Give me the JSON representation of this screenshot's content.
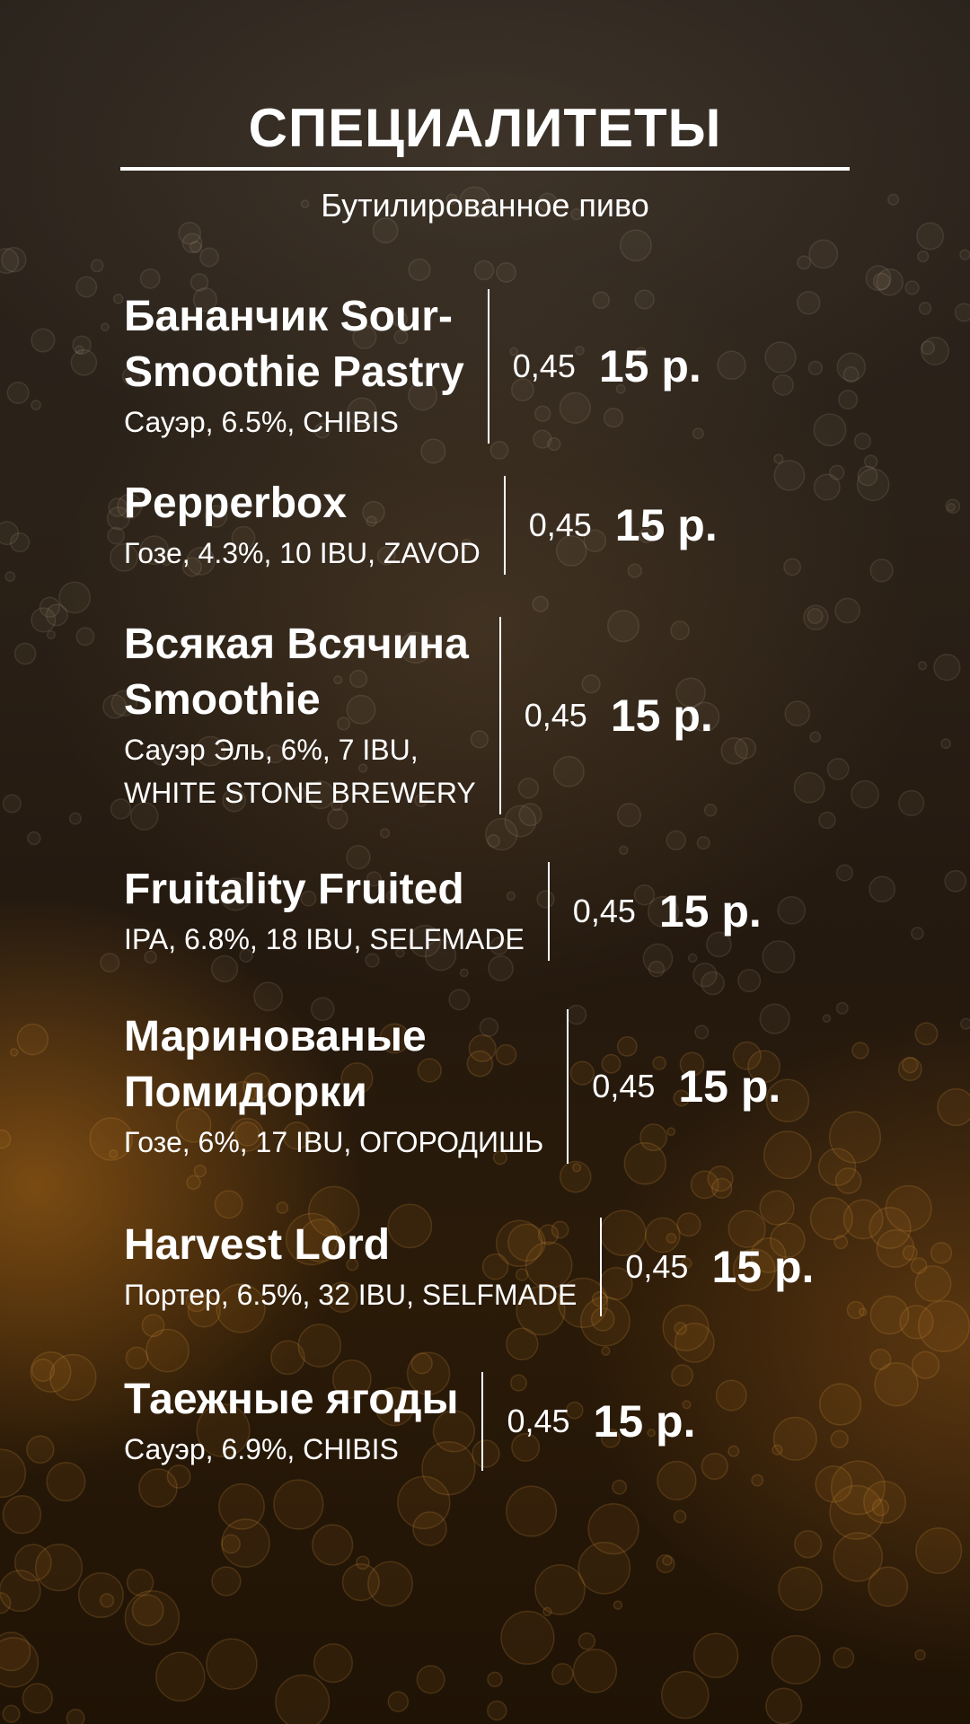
{
  "menu": {
    "title": "СПЕЦИАЛИТЕТЫ",
    "subtitle": "Бутилированное пиво",
    "items": [
      {
        "name": [
          "Бананчик Sour-",
          "Smoothie Pastry"
        ],
        "desc": [
          "Сауэр, 6.5%, CHIBIS"
        ],
        "volume": "0,45",
        "price": "15 р."
      },
      {
        "name": [
          "Pepperbox"
        ],
        "desc": [
          "Гозе, 4.3%, 10 IBU, ZAVOD"
        ],
        "volume": "0,45",
        "price": "15 р."
      },
      {
        "name": [
          "Всякая Всячина",
          "Smoothie"
        ],
        "desc": [
          "Сауэр Эль, 6%, 7 IBU,",
          "WHITE STONE BREWERY"
        ],
        "volume": "0,45",
        "price": "15 р."
      },
      {
        "name": [
          "Fruitality Fruited"
        ],
        "desc": [
          "IPA, 6.8%, 18 IBU, SELFMADE"
        ],
        "volume": "0,45",
        "price": "15 р."
      },
      {
        "name": [
          "Маринованые",
          "Помидорки"
        ],
        "desc": [
          "Гозе, 6%, 17 IBU, ОГОРОДИШЬ"
        ],
        "volume": "0,45",
        "price": "15 р."
      },
      {
        "name": [
          "Harvest Lord"
        ],
        "desc": [
          "Портер, 6.5%, 32 IBU, SELFMADE"
        ],
        "volume": "0,45",
        "price": "15 р."
      },
      {
        "name": [
          "Таежные ягоды"
        ],
        "desc": [
          "Сауэр, 6.9%, CHIBIS"
        ],
        "volume": "0,45",
        "price": "15 р."
      }
    ]
  },
  "colors": {
    "text": "#ffffff",
    "accent": "#c47a1e",
    "background": "#22190f"
  }
}
